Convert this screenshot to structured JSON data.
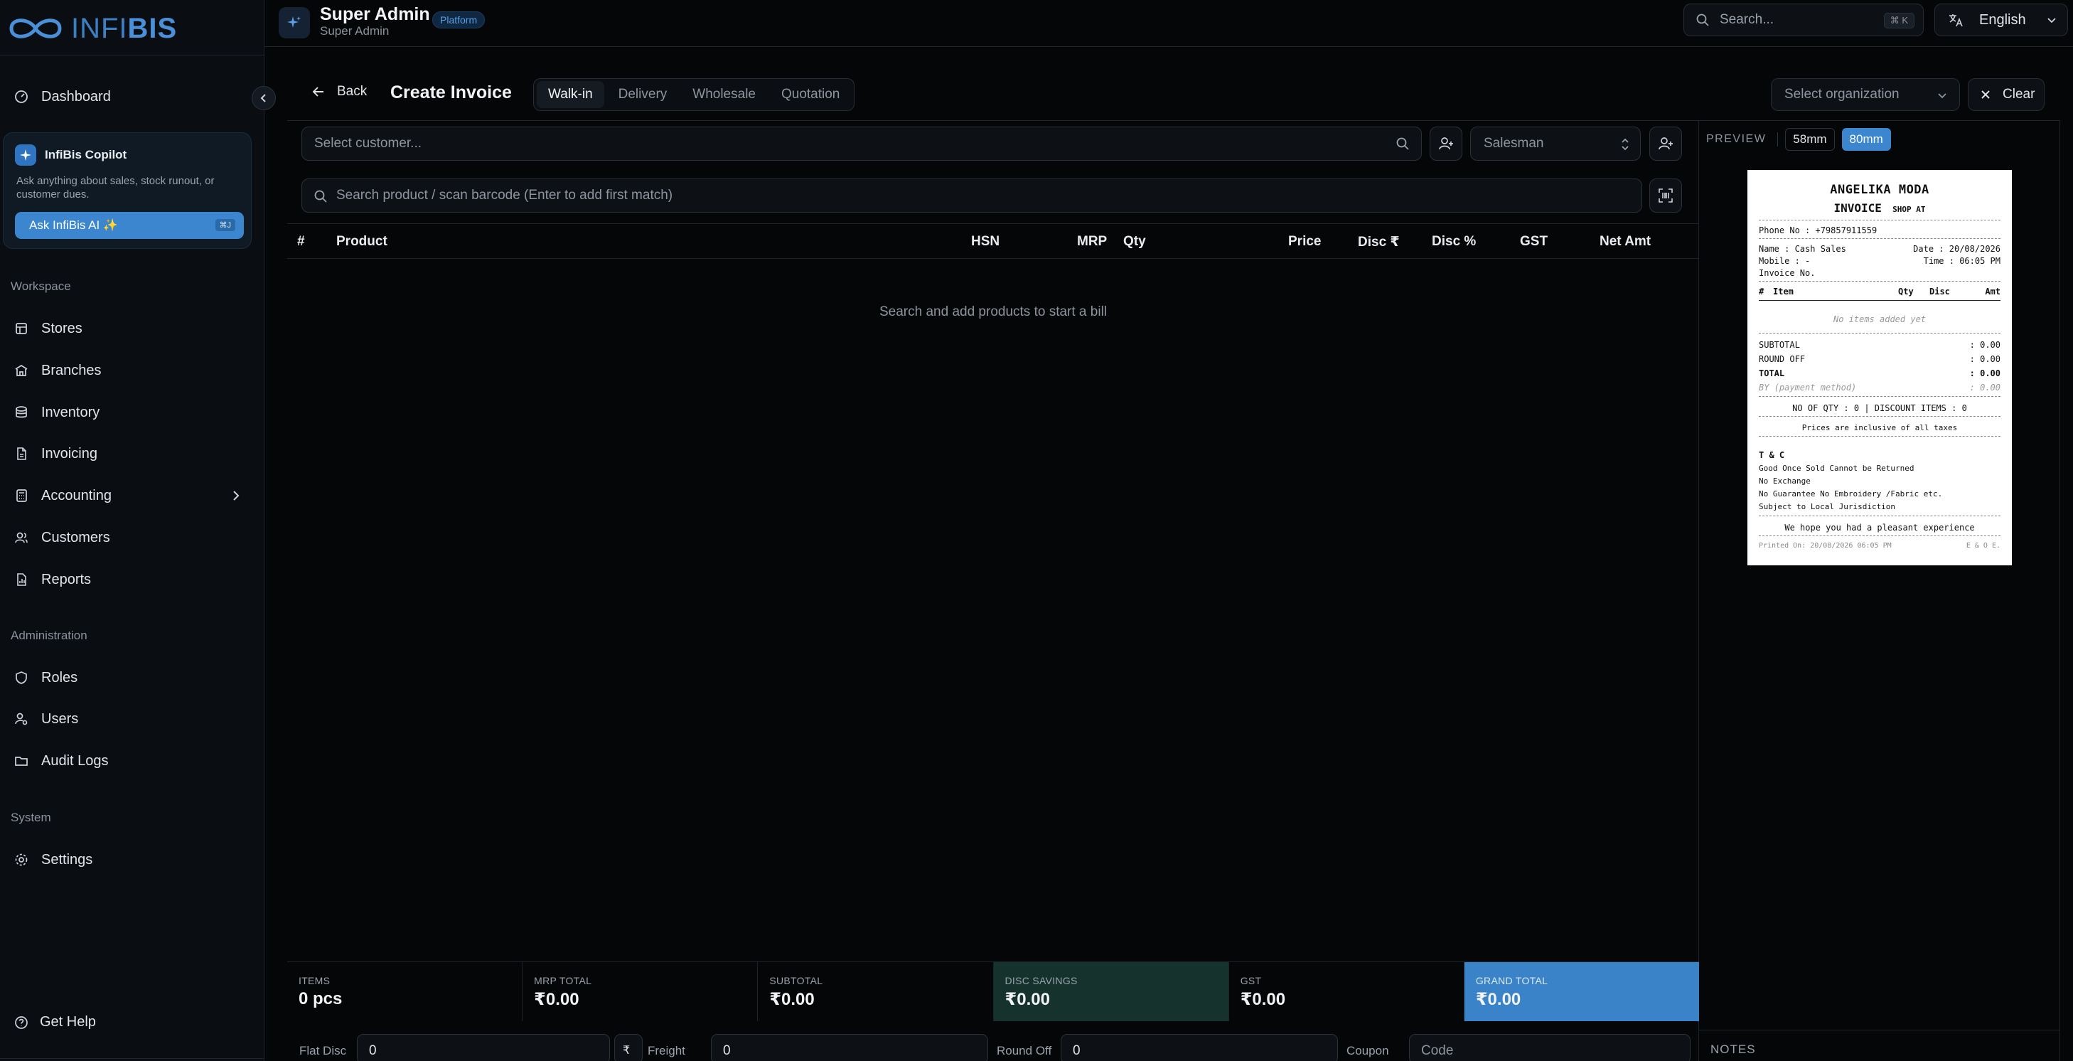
{
  "app": {
    "brand_light": "INFI",
    "brand_bold": "BIS"
  },
  "header": {
    "title": "Super Admin",
    "subtitle": "Super Admin",
    "badge": "Platform",
    "search_placeholder": "Search...",
    "search_shortcut": "⌘ K",
    "language": "English"
  },
  "sidebar": {
    "dashboard": "Dashboard",
    "copilot": {
      "title": "InfiBis Copilot",
      "description": "Ask anything about sales, stock runout, or customer dues.",
      "button": "Ask InfiBis AI ✨",
      "shortcut": "⌘J"
    },
    "workspace_label": "Workspace",
    "workspace": [
      "Stores",
      "Branches",
      "Inventory",
      "Invoicing",
      "Accounting",
      "Customers",
      "Reports"
    ],
    "administration_label": "Administration",
    "administration": [
      "Roles",
      "Users",
      "Audit Logs"
    ],
    "system_label": "System",
    "system": [
      "Settings"
    ],
    "help": "Get Help"
  },
  "page": {
    "back": "Back",
    "title": "Create Invoice",
    "tabs": [
      "Walk-in",
      "Delivery",
      "Wholesale",
      "Quotation"
    ],
    "active_tab": "Walk-in",
    "organization_placeholder": "Select organization",
    "clear": "Clear"
  },
  "form": {
    "customer_placeholder": "Select customer...",
    "salesman_placeholder": "Salesman",
    "product_search_placeholder": "Search product / scan barcode (Enter to add first match)"
  },
  "table": {
    "columns": [
      "#",
      "Product",
      "HSN",
      "MRP",
      "Qty",
      "Price",
      "Disc ₹",
      "Disc %",
      "GST",
      "Net Amt"
    ],
    "empty": "Search and add products to start a bill"
  },
  "totals": [
    {
      "label": "ITEMS",
      "value": "0 pcs"
    },
    {
      "label": "MRP TOTAL",
      "value": "₹0.00"
    },
    {
      "label": "SUBTOTAL",
      "value": "₹0.00"
    },
    {
      "label": "DISC SAVINGS",
      "value": "₹0.00"
    },
    {
      "label": "GST",
      "value": "₹0.00"
    },
    {
      "label": "GRAND TOTAL",
      "value": "₹0.00"
    }
  ],
  "bottom": {
    "flat_disc_label": "Flat Disc",
    "flat_disc_value": "0",
    "currency_symbol": "₹",
    "freight_label": "Freight",
    "freight_value": "0",
    "round_off_label": "Round Off",
    "round_off_value": "0",
    "coupon_label": "Coupon",
    "coupon_placeholder": "Code"
  },
  "preview": {
    "label": "PREVIEW",
    "sizes": [
      "58mm",
      "80mm"
    ],
    "active_size": "80mm",
    "notes_label": "NOTES",
    "receipt": {
      "shop": "ANGELIKA MODA",
      "doc": "INVOICE",
      "doc_suffix": "SHOP AT",
      "phone": "Phone No : +79857911559",
      "name": "Name : Cash Sales",
      "date": "Date : 20/08/2026",
      "mobile": "Mobile : -",
      "time": "Time : 06:05 PM",
      "invoice_no": "Invoice No.",
      "cols": [
        "#",
        "Item",
        "Qty",
        "Disc",
        "Amt"
      ],
      "no_items": "No items added yet",
      "subtotal_label": "SUBTOTAL",
      "subtotal": ": 0.00",
      "roundoff_label": "ROUND OFF",
      "roundoff": ": 0.00",
      "total_label": "TOTAL",
      "total": ": 0.00",
      "by_label": "BY (payment method)",
      "by": ": 0.00",
      "qty_line": "NO OF QTY : 0 | DISCOUNT ITEMS : 0",
      "tax_note": "Prices are inclusive of all taxes",
      "tc_title": "T & C",
      "tc": [
        "Good Once Sold Cannot be Returned",
        "No Exchange",
        "No Guarantee No Embroidery /Fabric etc.",
        "Subject to Local Jurisdiction"
      ],
      "thanks": "We hope you had a pleasant experience",
      "printed": "Printed On: 20/08/2026 06:05 PM",
      "eoe": "E & O E."
    }
  },
  "colors": {
    "accent": "#3b86cf",
    "savings_bg": "#15332c",
    "background": "#050608"
  }
}
